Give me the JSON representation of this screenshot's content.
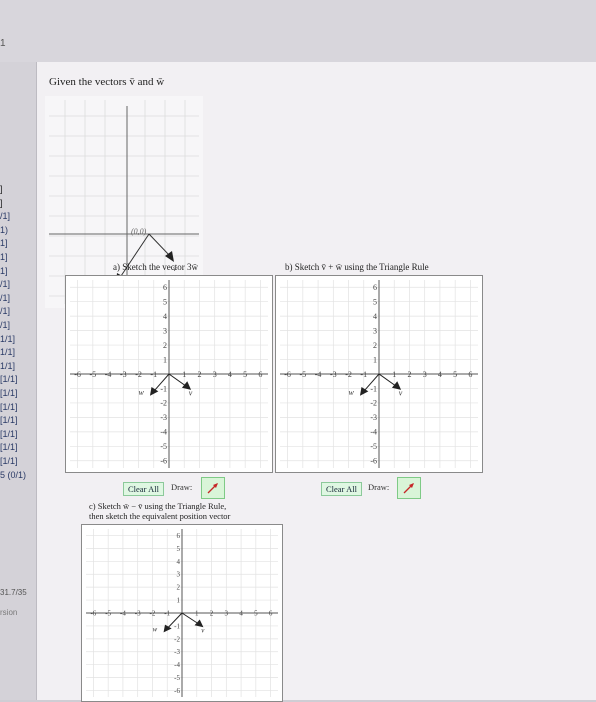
{
  "top_number": "1",
  "sidebar": {
    "scores": [
      "]",
      "]",
      "/1]",
      "1)",
      "1]",
      "1]",
      "1]",
      "/1]",
      "/1]",
      "/1]",
      "/1]",
      "1/1]",
      "1/1]",
      "1/1]",
      "[1/1]",
      "[1/1]",
      "[1/1]",
      "[1/1]",
      "[1/1]",
      "[1/1]",
      "[1/1]",
      "5 (0/1)"
    ],
    "total": "31.7/35",
    "version": "rsion"
  },
  "question": {
    "text": "Given the vectors v̄ and w̄"
  },
  "figure": {
    "origin_label": "(0,0)",
    "v_label": "v",
    "w_label": "w"
  },
  "graphs": {
    "a": {
      "caption": "a) Sketch the vector 3w̄",
      "x_ticks": [
        "-6",
        "-5",
        "-4",
        "-3",
        "-2",
        "-1",
        "1",
        "2",
        "3",
        "4",
        "5",
        "6"
      ],
      "y_ticks": [
        "6",
        "5",
        "4",
        "3",
        "2",
        "1",
        "-1",
        "-2",
        "-3",
        "-4",
        "-5",
        "-6"
      ],
      "v_label": "v",
      "w_label": "w",
      "clear_label": "Clear All",
      "draw_label": "Draw:"
    },
    "b": {
      "caption": "b) Sketch v̄ + w̄ using the Triangle Rule",
      "x_ticks": [
        "-6",
        "-5",
        "-4",
        "-3",
        "-2",
        "-1",
        "1",
        "2",
        "3",
        "4",
        "5",
        "6"
      ],
      "y_ticks": [
        "6",
        "5",
        "4",
        "3",
        "2",
        "1",
        "-1",
        "-2",
        "-3",
        "-4",
        "-5",
        "-6"
      ],
      "v_label": "v",
      "w_label": "w",
      "clear_label": "Clear All",
      "draw_label": "Draw:"
    },
    "c": {
      "caption_line1": "c) Sketch w̄ − v̄ using the Triangle Rule,",
      "caption_line2": "then sketch the equivalent position vector",
      "x_ticks": [
        "-6",
        "-5",
        "-4",
        "-3",
        "-2",
        "-1",
        "1",
        "2",
        "3",
        "4",
        "5",
        "6"
      ],
      "y_ticks": [
        "6",
        "5",
        "4",
        "3",
        "2",
        "1",
        "-1",
        "-2",
        "-3",
        "-4",
        "-5",
        "-6"
      ],
      "v_label": "v",
      "w_label": "w"
    }
  },
  "colors": {
    "button_bg": "#dff7e2",
    "tool_bg": "#d9f5d8",
    "grid": "#e2e2e2",
    "axis": "#555555"
  }
}
